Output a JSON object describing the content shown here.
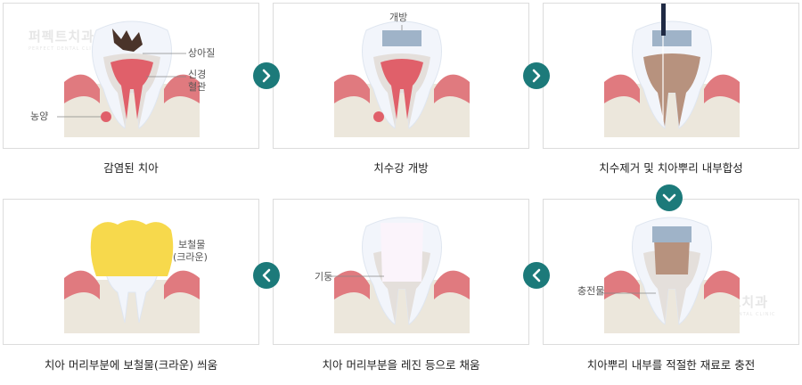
{
  "steps": [
    {
      "caption": "감염된 치아",
      "labels": {
        "a": "상아질",
        "b": "신경",
        "c": "혈관",
        "d": "농양"
      }
    },
    {
      "caption": "치수강 개방",
      "labels": {
        "a": "개방"
      }
    },
    {
      "caption": "치수제거 및 치아뿌리 내부합성"
    },
    {
      "caption": "치아 머리부분에 보철물(크라운) 씌움",
      "labels": {
        "a": "보철물",
        "b": "(크라운)"
      }
    },
    {
      "caption": "치아 머리부분을 레진 등으로 채움",
      "labels": {
        "a": "기둥"
      }
    },
    {
      "caption": "치아뿌리 내부를 적절한 재료로 충전",
      "labels": {
        "a": "충전물"
      }
    }
  ],
  "watermark": {
    "text": "퍼펙트치과",
    "sub": "PERFECT DENTAL CLINIC"
  },
  "colors": {
    "accent": "#1c7a7a",
    "gum": "#e07a7f",
    "bone": "#ece7dc",
    "pulp": "#e0606a",
    "decay": "#4a342a",
    "filling": "#b7927e",
    "opening": "#9fb3c8",
    "crown": "#f7d94c"
  }
}
